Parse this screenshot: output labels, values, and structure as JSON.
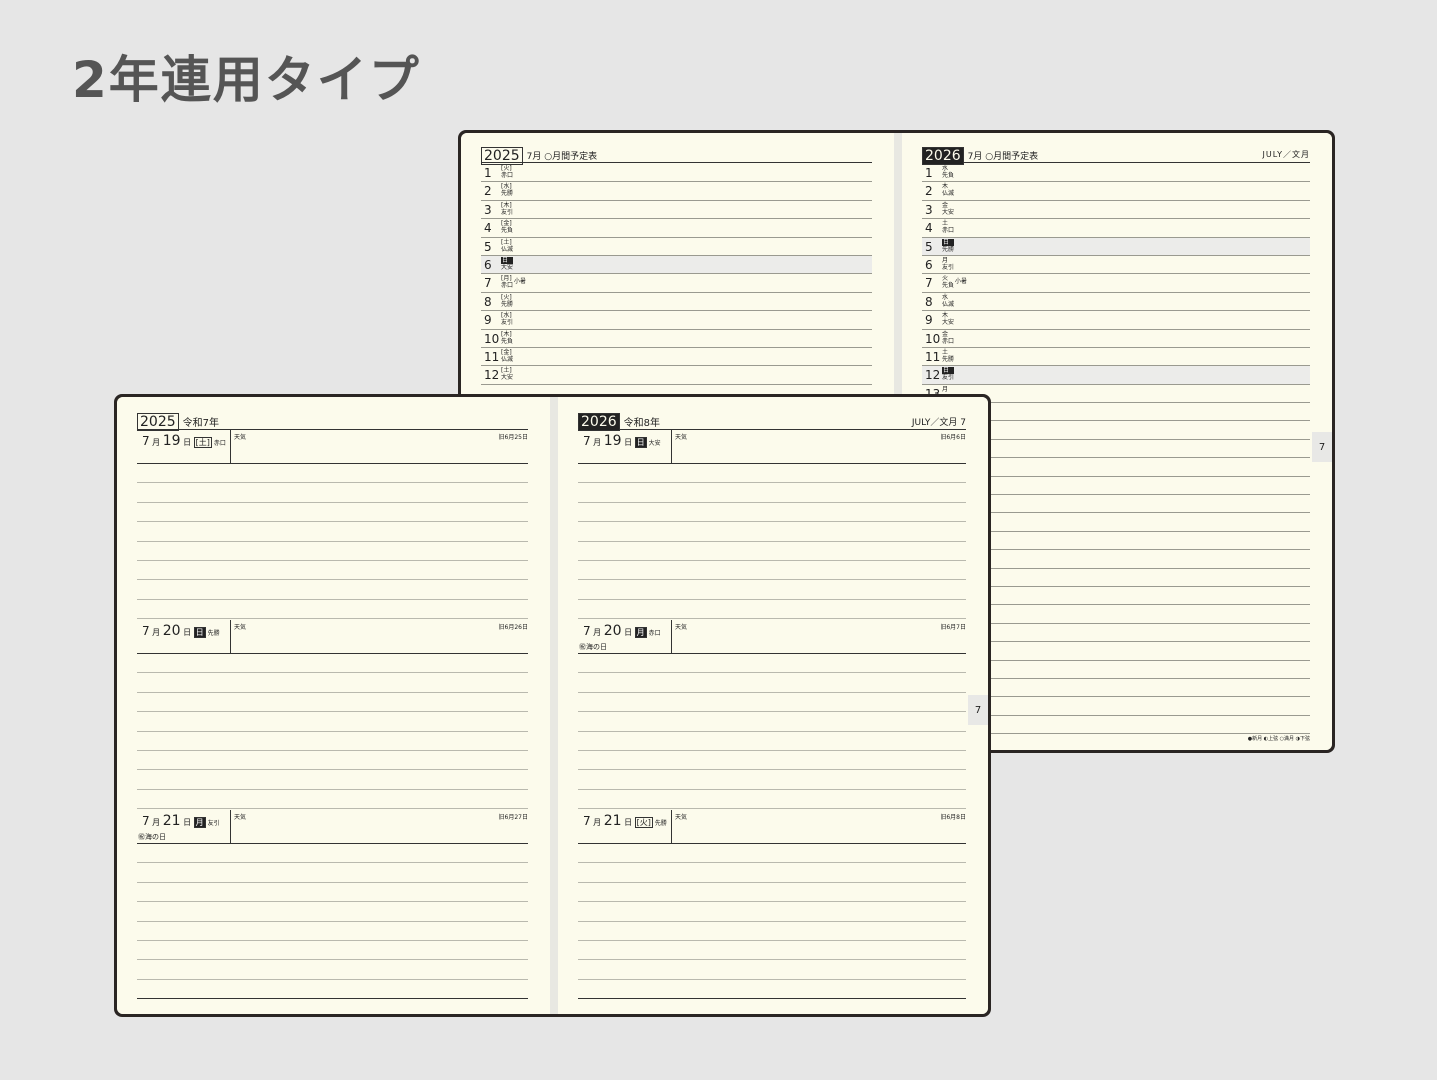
{
  "heading": "2年連用タイプ",
  "back_book": {
    "left": {
      "year": "2025",
      "subtitle": "7月 ○月間予定表",
      "rows": [
        {
          "n": "1",
          "w": "[火]",
          "r": "赤口"
        },
        {
          "n": "2",
          "w": "[水]",
          "r": "先勝"
        },
        {
          "n": "3",
          "w": "[木]",
          "r": "友引"
        },
        {
          "n": "4",
          "w": "[金]",
          "r": "先負"
        },
        {
          "n": "5",
          "w": "[土]",
          "r": "仏滅"
        },
        {
          "n": "6",
          "w": "日",
          "r": "大安",
          "shade": true
        },
        {
          "n": "7",
          "w": "[月]",
          "r": "赤口",
          "note": "小暑"
        },
        {
          "n": "8",
          "w": "[火]",
          "r": "先勝"
        },
        {
          "n": "9",
          "w": "[水]",
          "r": "友引"
        },
        {
          "n": "10",
          "w": "[木]",
          "r": "先負"
        },
        {
          "n": "11",
          "w": "[金]",
          "r": "仏滅"
        },
        {
          "n": "12",
          "w": "[土]",
          "r": "大安"
        }
      ]
    },
    "right": {
      "year": "2026",
      "subtitle": "7月 ○月間予定表",
      "eng": "JULY／文月",
      "rows": [
        {
          "n": "1",
          "w": "水",
          "r": "先負"
        },
        {
          "n": "2",
          "w": "木",
          "r": "仏滅"
        },
        {
          "n": "3",
          "w": "金",
          "r": "大安"
        },
        {
          "n": "4",
          "w": "土",
          "r": "赤口"
        },
        {
          "n": "5",
          "w": "日",
          "r": "先勝",
          "shade": true
        },
        {
          "n": "6",
          "w": "月",
          "r": "友引"
        },
        {
          "n": "7",
          "w": "火",
          "r": "先負",
          "note": "小暑"
        },
        {
          "n": "8",
          "w": "水",
          "r": "仏滅"
        },
        {
          "n": "9",
          "w": "木",
          "r": "大安"
        },
        {
          "n": "10",
          "w": "金",
          "r": "赤口"
        },
        {
          "n": "11",
          "w": "土",
          "r": "先勝"
        },
        {
          "n": "12",
          "w": "日",
          "r": "友引",
          "shade": true
        },
        {
          "n": "13",
          "w": "月",
          "r": ""
        }
      ],
      "tab": "7",
      "legend": "●新月 ◐上弦 ○満月 ◑下弦"
    }
  },
  "front_book": {
    "left": {
      "year": "2025",
      "subtitle": "令和7年",
      "days": [
        {
          "m": "7",
          "d": "19",
          "w": "[土]",
          "r": "赤口",
          "wx": "天気",
          "lunar": "旧6月25日"
        },
        {
          "m": "7",
          "d": "20",
          "w": "日",
          "r": "先勝",
          "wx": "天気",
          "lunar": "旧6月26日"
        },
        {
          "m": "7",
          "d": "21",
          "w": "月",
          "r": "友引",
          "wx": "天気",
          "lunar": "旧6月27日",
          "hol": "㊗海の日"
        }
      ]
    },
    "right": {
      "year": "2026",
      "subtitle": "令和8年",
      "eng": "JULY／文月 7",
      "days": [
        {
          "m": "7",
          "d": "19",
          "w": "日",
          "r": "大安",
          "wx": "天気",
          "lunar": "旧6月6日"
        },
        {
          "m": "7",
          "d": "20",
          "w": "月",
          "r": "赤口",
          "wx": "天気",
          "lunar": "旧6月7日",
          "hol": "㊗海の日"
        },
        {
          "m": "7",
          "d": "21",
          "w": "[火]",
          "r": "先勝",
          "wx": "天気",
          "lunar": "旧6月8日"
        }
      ],
      "tab": "7"
    }
  }
}
